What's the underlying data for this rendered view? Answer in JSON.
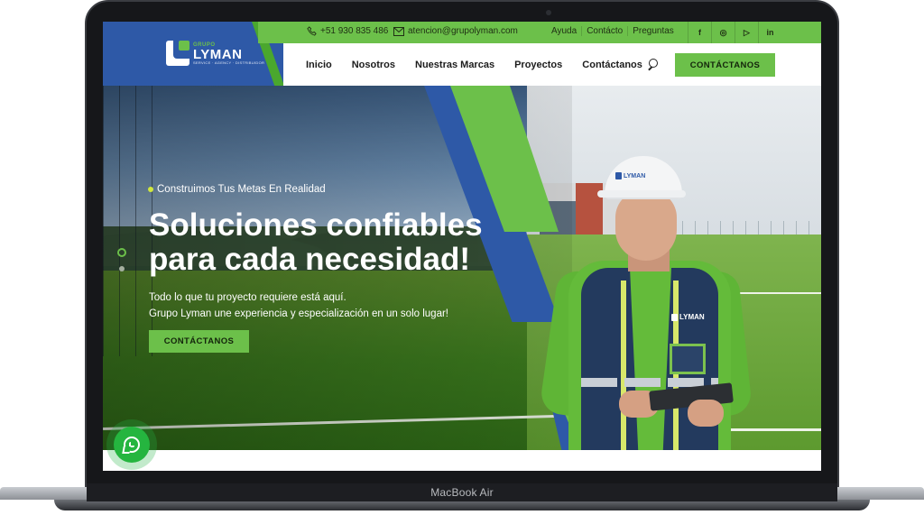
{
  "device": {
    "model_label": "MacBook Air"
  },
  "brand": {
    "logo_small": "GRUPO",
    "logo_big": "LYMAN",
    "logo_tagline": "SERVICE · AGENCY · DISTRIBUIDOR"
  },
  "topbar": {
    "phone": "+51 930 835 486",
    "email": "atencion@grupolyman.com",
    "links": [
      "Ayuda",
      "Contácto",
      "Preguntas"
    ],
    "socials": [
      "f",
      "◎",
      "▷",
      "in"
    ]
  },
  "nav": {
    "items": [
      "Inicio",
      "Nosotros",
      "Nuestras Marcas",
      "Proyectos",
      "Contáctanos"
    ],
    "cta": "CONTÁCTANOS"
  },
  "hero": {
    "eyebrow": "Construimos Tus Metas En Realidad",
    "headline_line1": "Soluciones confiables",
    "headline_line2": "para cada necesidad!",
    "sub_line1": "Todo lo que tu proyecto requiere está aquí.",
    "sub_line2": "Grupo Lyman une experiencia y especialización en un solo lugar!",
    "cta": "CONTÁCTANOS",
    "vest_badge": "LYMAN",
    "helmet_badge": "LYMAN"
  },
  "colors": {
    "brand_blue": "#2e59a7",
    "brand_green": "#6cc04a",
    "whatsapp": "#25b53f"
  },
  "icons": {
    "phone": "phone-icon",
    "email": "email-icon",
    "search": "search-icon",
    "whatsapp": "whatsapp-icon"
  }
}
